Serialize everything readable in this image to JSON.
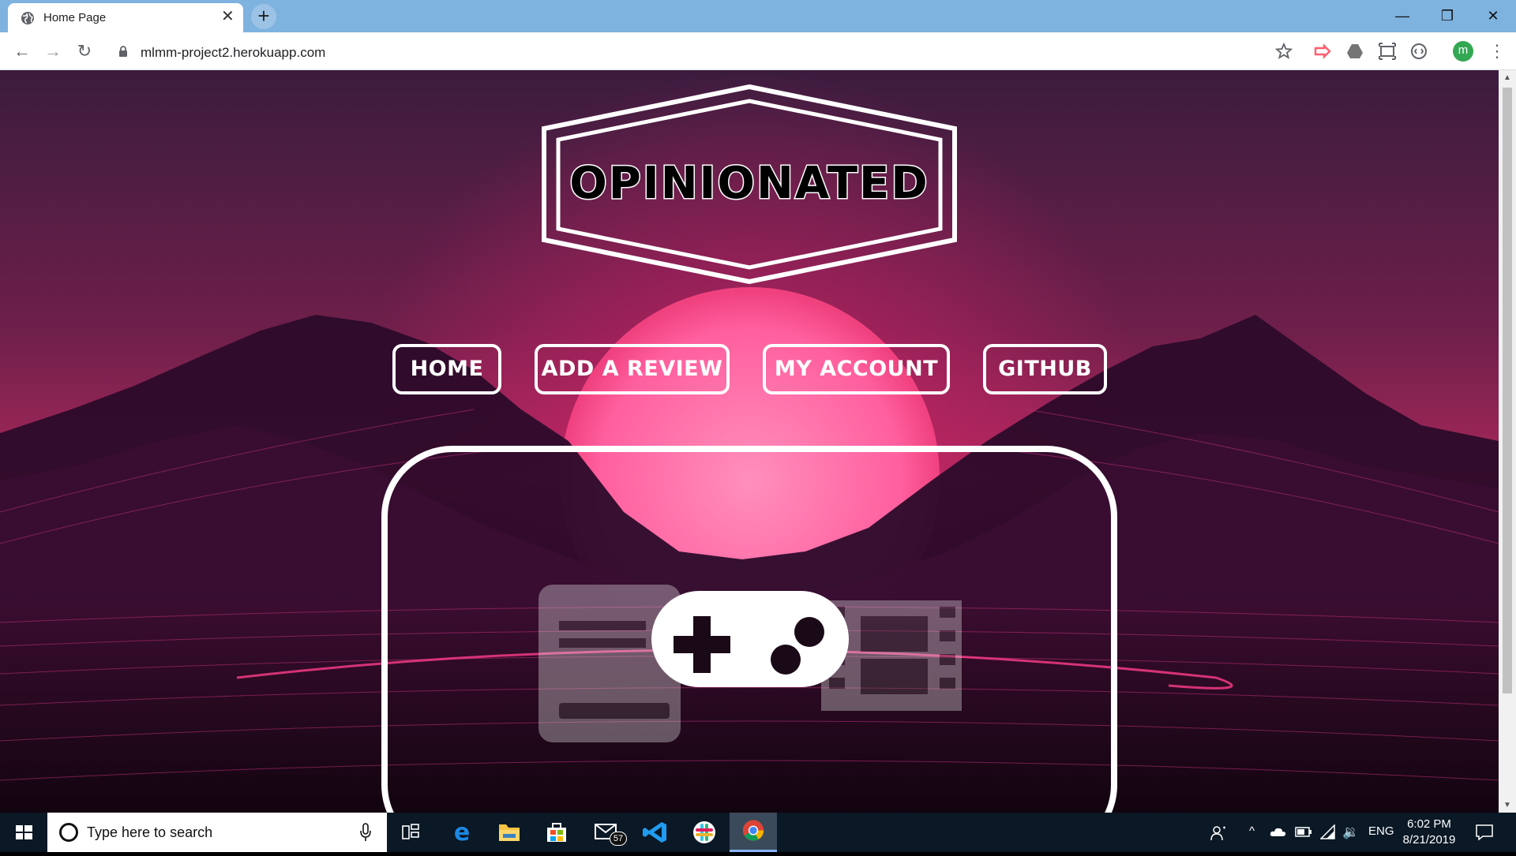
{
  "browser": {
    "tab_title": "Home Page",
    "tab_close": "✕",
    "new_tab": "+",
    "url": "mlmm-project2.herokuapp.com",
    "avatar_letter": "m"
  },
  "window_controls": {
    "minimize": "—",
    "restore": "❐",
    "close": "✕"
  },
  "site": {
    "logo_text": "OPINIONATED",
    "nav": [
      "HOME",
      "ADD A REVIEW",
      "MY ACCOUNT",
      "GITHUB"
    ]
  },
  "taskbar": {
    "search_placeholder": "Type here to search",
    "mail_badge": "57",
    "language": "ENG",
    "time": "6:02 PM",
    "date": "8/21/2019"
  }
}
